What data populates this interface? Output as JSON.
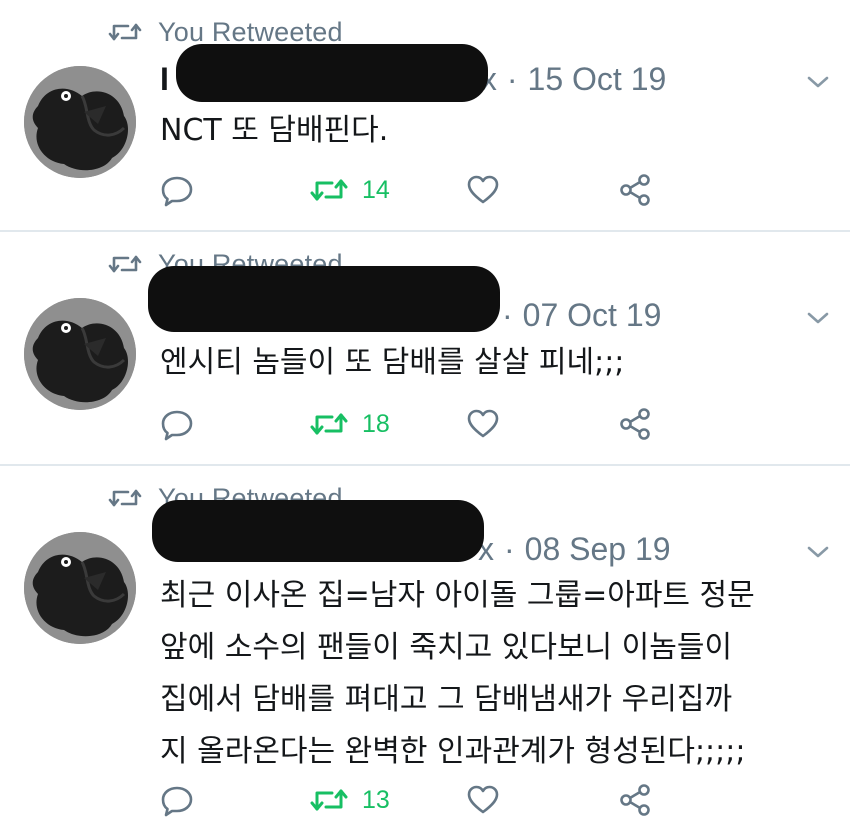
{
  "colors": {
    "retweet_active": "#17bf63",
    "secondary_text": "#657786",
    "primary_text": "#14171a",
    "divider": "#e1e8ed"
  },
  "tweets": [
    {
      "retweet_label": "You Retweeted",
      "name_prefix": "I",
      "handle_tail": "x",
      "dot": "·",
      "date": "15 Oct 19",
      "text": "NCT 또 담배핀다.",
      "retweet_count": "14",
      "icons": [
        "retweet-icon",
        "chevron-down-icon",
        "reply-icon",
        "retweet-icon",
        "like-icon",
        "share-icon"
      ]
    },
    {
      "retweet_label": "You Retweeted",
      "name_prefix": "",
      "handle_tail": "",
      "dot": "·",
      "date": "07 Oct 19",
      "text": "엔시티 놈들이 또 담배를 살살 피네;;;",
      "retweet_count": "18",
      "icons": [
        "retweet-icon",
        "chevron-down-icon",
        "reply-icon",
        "retweet-icon",
        "like-icon",
        "share-icon"
      ]
    },
    {
      "retweet_label": "You Retweeted",
      "name_prefix": "",
      "handle_tail": "x",
      "dot": "·",
      "date": "08 Sep 19",
      "text": "최근 이사온 집=남자 아이돌 그룹=아파트 정문\n앞에 소수의 팬들이 죽치고 있다보니 이놈들이\n집에서 담배를 펴대고 그 담배냄새가 우리집까\n지 올라온다는 완벽한 인과관계가 형성된다;;;;;",
      "retweet_count": "13",
      "icons": [
        "retweet-icon",
        "chevron-down-icon",
        "reply-icon",
        "retweet-icon",
        "like-icon",
        "share-icon"
      ]
    }
  ]
}
